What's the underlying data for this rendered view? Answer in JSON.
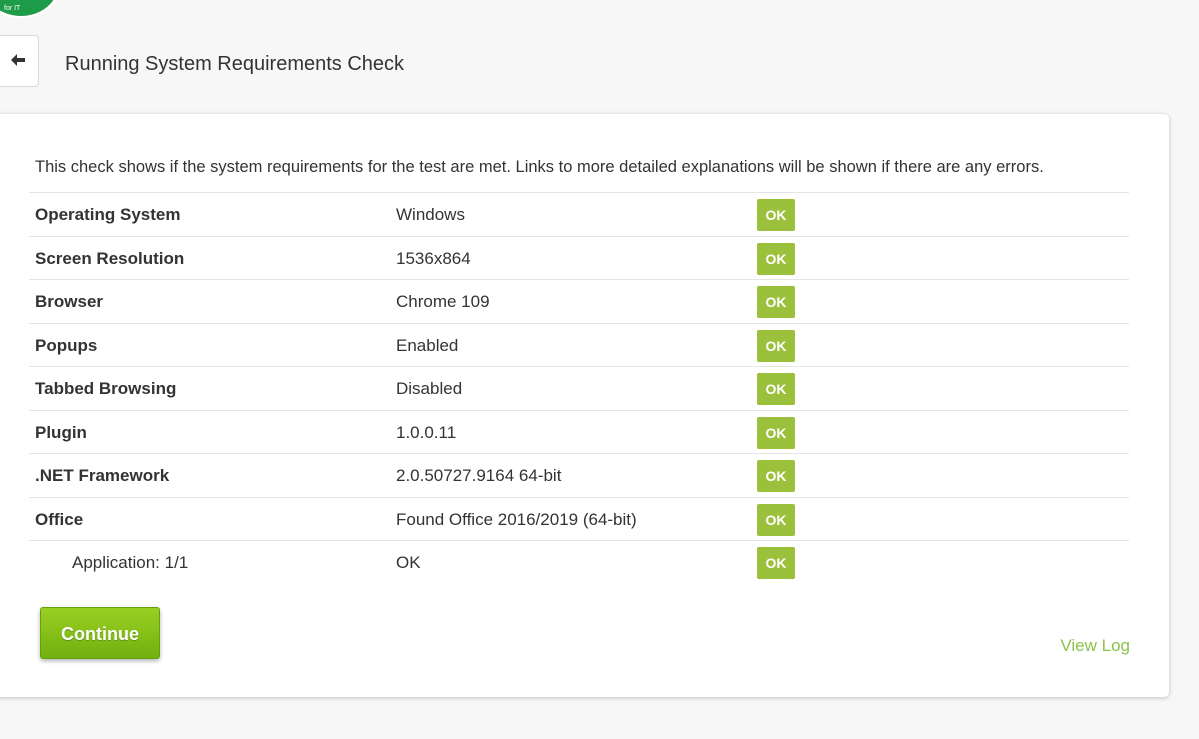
{
  "header": {
    "logo_text": "for IT",
    "back_icon": "arrow-left-icon",
    "title": "Running System Requirements Check"
  },
  "panel": {
    "intro": "This check shows if the system requirements for the test are met. Links to more detailed explanations will be shown if there are any errors.",
    "rows": [
      {
        "name": "Operating System",
        "value": "Windows",
        "status": "OK"
      },
      {
        "name": "Screen Resolution",
        "value": "1536x864",
        "status": "OK"
      },
      {
        "name": "Browser",
        "value": "Chrome 109",
        "status": "OK"
      },
      {
        "name": "Popups",
        "value": "Enabled",
        "status": "OK"
      },
      {
        "name": "Tabbed Browsing",
        "value": "Disabled",
        "status": "OK"
      },
      {
        "name": "Plugin",
        "value": "1.0.0.11",
        "status": "OK"
      },
      {
        "name": ".NET Framework",
        "value": "2.0.50727.9164 64-bit",
        "status": "OK"
      },
      {
        "name": "Office",
        "value": "Found Office 2016/2019 (64-bit)",
        "status": "OK"
      },
      {
        "name": "Application: 1/1",
        "value": "OK",
        "status": "OK"
      }
    ],
    "continue_label": "Continue",
    "view_log_label": "View Log"
  },
  "colors": {
    "ok_badge": "#9bc13c",
    "continue_button": "#84c11a",
    "link": "#8bc34a",
    "logo": "#1e9b48"
  }
}
